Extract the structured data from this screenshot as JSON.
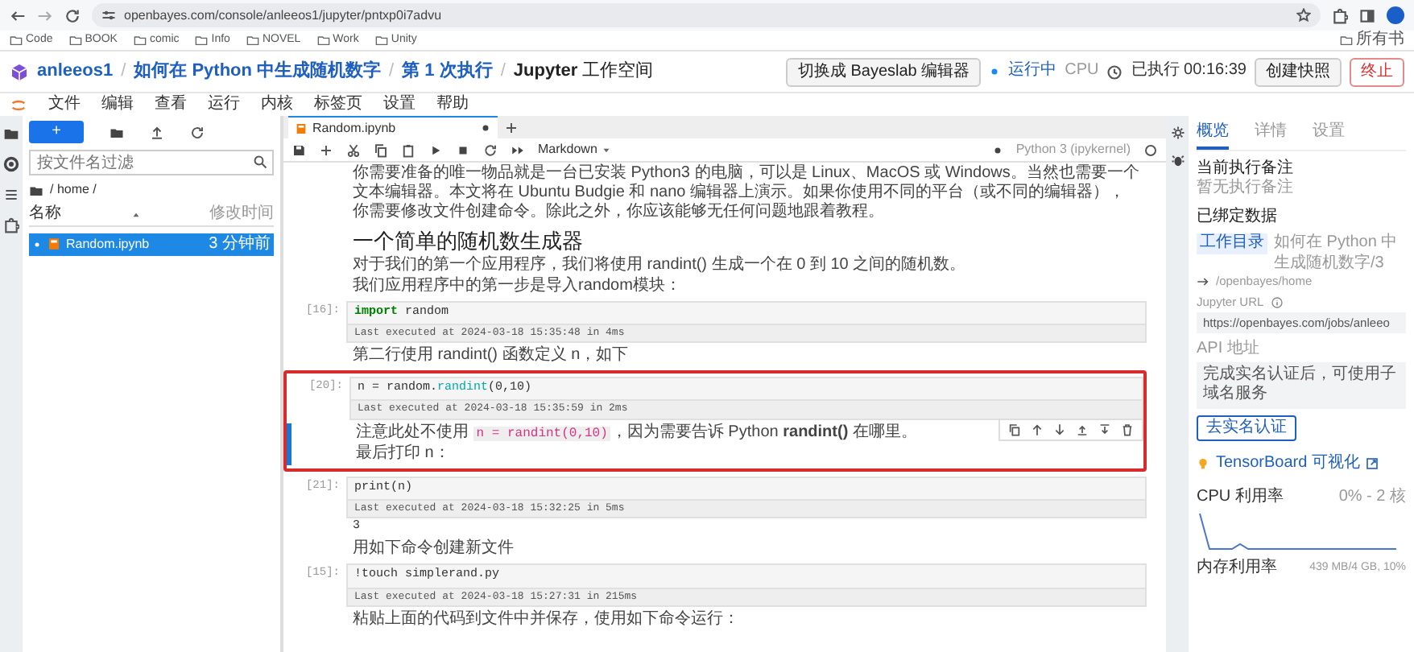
{
  "browser": {
    "url": "openbayes.com/console/anleeos1/jupyter/pntxp0i7advu",
    "bookmarks": [
      "Code",
      "BOOK",
      "comic",
      "Info",
      "NOVEL",
      "Work",
      "Unity"
    ],
    "bookmarks_overflow": "所有书"
  },
  "header": {
    "breadcrumb": [
      "anleeos1",
      "如何在 Python 中生成随机数字",
      "第 1 次执行",
      "**Jupyter** 工作空间"
    ],
    "separator": "/",
    "switch_button": "切换成 Bayeslab 编辑器",
    "status": "运行中",
    "cpu": "CPU",
    "elapsed": "已执行 00:16:39",
    "snapshot_button": "创建快照",
    "stop_button": "终止"
  },
  "menu": [
    "文件",
    "编辑",
    "查看",
    "运行",
    "内核",
    "标签页",
    "设置",
    "帮助"
  ],
  "file_browser": {
    "new_button": "+",
    "filter_placeholder": "按文件名过滤",
    "path": "/ home /",
    "columns": [
      "名称",
      "修改时间"
    ],
    "files": [
      {
        "name": "Random.ipynb",
        "modified": "3 分钟前",
        "selected": true,
        "running": true
      }
    ]
  },
  "notebook": {
    "tab": {
      "title": "Random.ipynb",
      "unsaved": true
    },
    "cell_type": "Markdown",
    "kernel": "Python 3 (ipykernel)",
    "cells": [
      {
        "kind": "markdown",
        "selected": false,
        "highlighted": false,
        "blocks": [
          {
            "kind": "p",
            "parts": [
              {
                "text": "你需要准备的唯一物品就是一台已安装 Python3 的电脑，可以是 Linux、MacOS 或 Windows。当然也需要一个文本编辑器。本文将在 Ubuntu Budgie 和 nano 编辑器上演示。如果你使用不同的平台（或不同的编辑器），你需要修改文件创建命令。除此之外，你应该能够无任何问题地跟着教程。",
                "kind": "plain"
              }
            ]
          }
        ]
      },
      {
        "kind": "markdown",
        "selected": false,
        "highlighted": false,
        "blocks": [
          {
            "kind": "h2",
            "parts": [
              {
                "text": "一个简单的随机数生成器",
                "kind": "plain"
              }
            ]
          },
          {
            "kind": "p",
            "parts": [
              {
                "text": "对于我们的第一个应用程序，我们将使用 randint() 生成一个在 0 到 10 之间的随机数。",
                "kind": "plain"
              }
            ]
          },
          {
            "kind": "p",
            "parts": [
              {
                "text": "我们应用程序中的第一步是导入random模块：",
                "kind": "plain"
              }
            ]
          }
        ]
      },
      {
        "kind": "code",
        "selected": false,
        "highlighted": false,
        "prompt": "[16]:",
        "tokens": [
          {
            "text": "import",
            "kind": "keyword"
          },
          {
            "text": " random",
            "kind": "plain"
          }
        ],
        "executed": "Last executed at 2024-03-18 15:35:48 in 4ms"
      },
      {
        "kind": "markdown",
        "selected": false,
        "highlighted": false,
        "blocks": [
          {
            "kind": "p",
            "parts": [
              {
                "text": "第二行使用 randint() 函数定义 n，如下",
                "kind": "plain"
              }
            ]
          }
        ]
      },
      {
        "kind": "code",
        "selected": false,
        "highlighted": true,
        "prompt": "[20]:",
        "tokens": [
          {
            "text": "n = random.",
            "kind": "plain"
          },
          {
            "text": "randint",
            "kind": "function"
          },
          {
            "text": "(0,10)",
            "kind": "plain"
          }
        ],
        "executed": "Last executed at 2024-03-18 15:35:59 in 2ms"
      },
      {
        "kind": "markdown",
        "selected": true,
        "highlighted": true,
        "blocks": [
          {
            "kind": "p",
            "parts": [
              {
                "text": "注意此处不使用 ",
                "kind": "plain"
              },
              {
                "text": "n = randint(0,10)",
                "kind": "code"
              },
              {
                "text": "，因为需要告诉 Python **randint()** 在哪里。",
                "kind": "plain"
              }
            ]
          },
          {
            "kind": "p",
            "parts": [
              {
                "text": "最后打印 n：",
                "kind": "plain"
              }
            ]
          }
        ]
      },
      {
        "kind": "code",
        "selected": false,
        "highlighted": false,
        "prompt": "[21]:",
        "tokens": [
          {
            "text": "print(n)",
            "kind": "plain"
          }
        ],
        "executed": "Last executed at 2024-03-18 15:32:25 in 5ms",
        "output": "3"
      },
      {
        "kind": "markdown",
        "selected": false,
        "highlighted": false,
        "blocks": [
          {
            "kind": "p",
            "parts": [
              {
                "text": "用如下命令创建新文件",
                "kind": "plain"
              }
            ]
          }
        ]
      },
      {
        "kind": "code",
        "selected": false,
        "highlighted": false,
        "prompt": "[15]:",
        "tokens": [
          {
            "text": "!touch simplerand.py",
            "kind": "plain"
          }
        ],
        "executed": "Last executed at 2024-03-18 15:27:31 in 215ms"
      },
      {
        "kind": "markdown",
        "selected": false,
        "highlighted": false,
        "blocks": [
          {
            "kind": "p",
            "parts": [
              {
                "text": "粘贴上面的代码到文件中并保存，使用如下命令运行：",
                "kind": "plain"
              }
            ]
          }
        ]
      }
    ]
  },
  "side_panel": {
    "tabs": [
      {
        "label": "概览",
        "selected": true
      },
      {
        "label": "详情",
        "selected": false
      },
      {
        "label": "设置",
        "selected": false
      }
    ],
    "notes_title": "当前执行备注",
    "notes_empty": "暂无执行备注",
    "bound_data_title": "已绑定数据",
    "bound_data": [
      {
        "tag": "工作目录",
        "name": "如何在 Python 中生成随机数字/3",
        "mount": "/openbayes/home"
      }
    ],
    "jupyter_url_label": "Jupyter URL",
    "jupyter_url": "https://openbayes.com/jobs/anleeo",
    "api_label": "API 地址",
    "api_note": "完成实名认证后，可使用子域名服务",
    "verify_button": "去实名认证",
    "tensorboard_link": "TensorBoard 可视化",
    "cpu_label": "CPU 利用率",
    "cpu_value": "0% - 2 核",
    "memory_label": "内存利用率",
    "memory_value": "439 MB/4 GB, 10%"
  }
}
